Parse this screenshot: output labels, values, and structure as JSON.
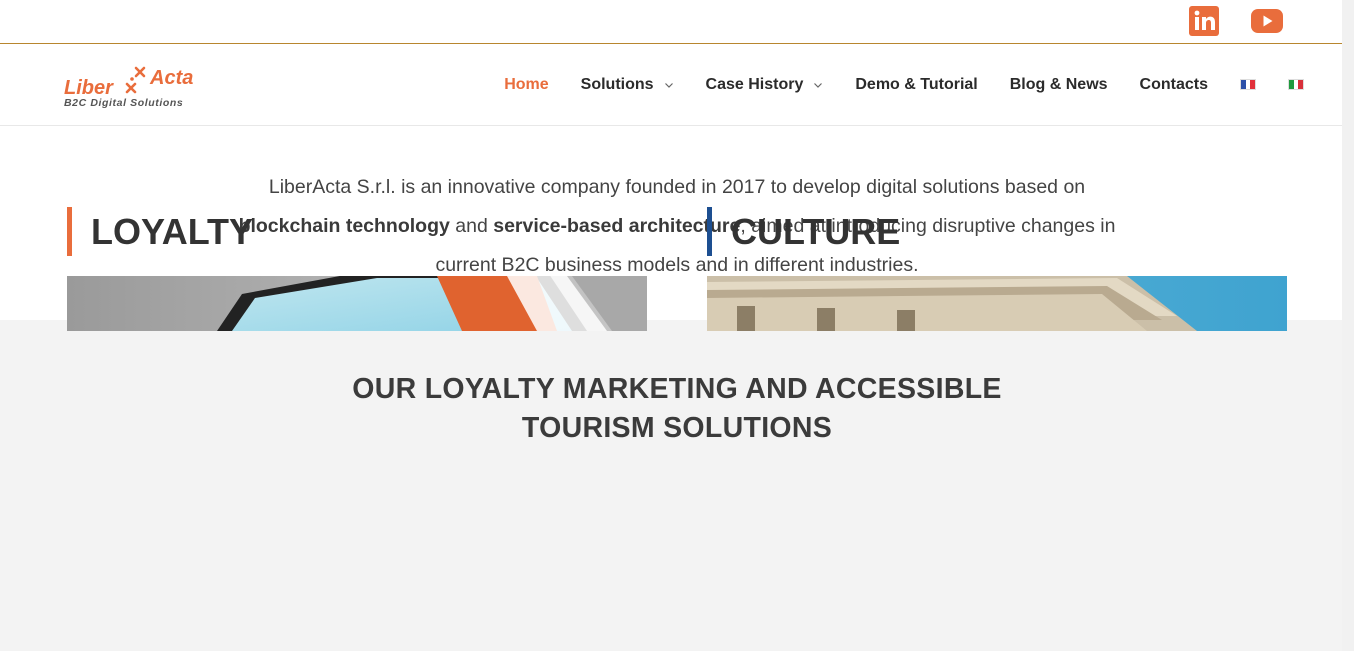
{
  "topbar": {
    "social": [
      {
        "name": "linkedin-icon",
        "color": "#e96d3c"
      },
      {
        "name": "youtube-icon",
        "color": "#e96d3c"
      }
    ]
  },
  "header": {
    "logo": {
      "word1": "Liber",
      "word2": "Acta",
      "tagline": "B2C Digital Solutions"
    },
    "nav": [
      {
        "label": "Home",
        "active": true,
        "dropdown": false
      },
      {
        "label": "Solutions",
        "active": false,
        "dropdown": true
      },
      {
        "label": "Case History",
        "active": false,
        "dropdown": true
      },
      {
        "label": "Demo & Tutorial",
        "active": false,
        "dropdown": false
      },
      {
        "label": "Blog & News",
        "active": false,
        "dropdown": false
      },
      {
        "label": "Contacts",
        "active": false,
        "dropdown": false
      }
    ],
    "languages": [
      {
        "code": "fr-flag-icon"
      },
      {
        "code": "it-flag-icon"
      }
    ]
  },
  "intro": {
    "part1": "LiberActa S.r.l. is an innovative company founded in 2017 to develop digital solutions based on ",
    "bold1": "blockchain technology",
    "part2": " and ",
    "bold2": "service-based architecture",
    "part3": ", aimed at introducing disruptive changes in current B2C business models and in different industries."
  },
  "solutions": {
    "title_line1": "OUR LOYALTY MARKETING AND ACCESSIBLE",
    "title_line2": "TOURISM SOLUTIONS",
    "columns": [
      {
        "title": "LOYALTY",
        "accent": "#e96d3c"
      },
      {
        "title": "CULTURE",
        "accent": "#1d4f91"
      }
    ]
  },
  "colors": {
    "accent": "#e96d3c",
    "culture_blue": "#1d4f91",
    "band_bg": "#f3f3f3"
  }
}
